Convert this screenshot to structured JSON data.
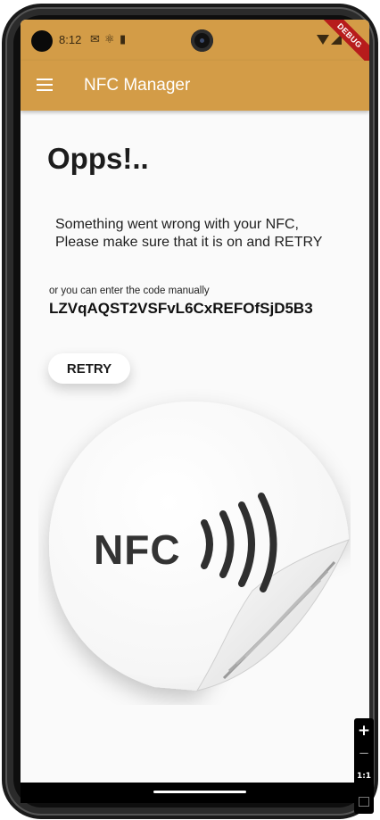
{
  "status_bar": {
    "time": "8:12",
    "debug_label": "DEBUG"
  },
  "app_bar": {
    "title": "NFC Manager",
    "menu_icon": "hamburger-menu-icon",
    "color": "#d39c47"
  },
  "content": {
    "heading": "Opps!..",
    "message_line1": "Something went wrong with your NFC,",
    "message_line2": "Please make sure that it is on and RETRY",
    "hint": "or you can enter the code manually",
    "code": "LZVqAQST2VSFvL6CxREFOfSjD5B3",
    "retry_label": "RETRY",
    "nfc_sticker_text": "NFC"
  },
  "zoom_controls": {
    "zoom_in": "+",
    "zoom_out": "−",
    "reset": "1:1"
  }
}
